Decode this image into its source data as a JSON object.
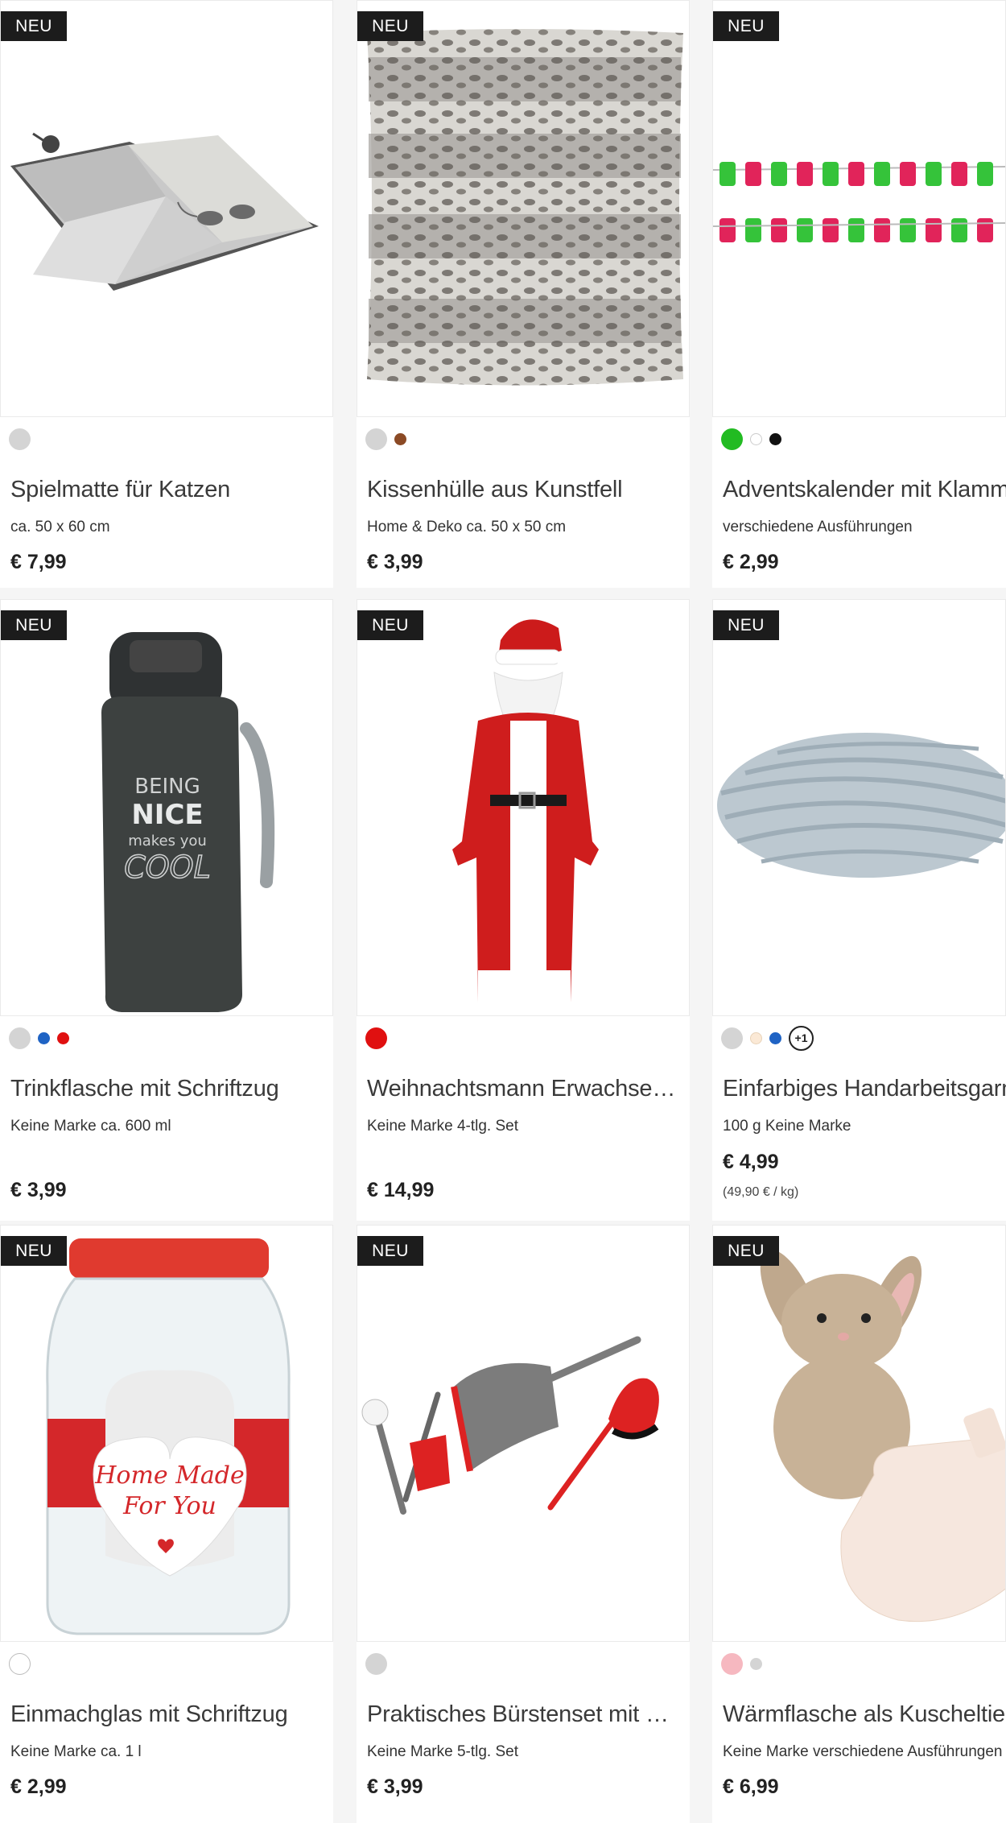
{
  "badge_label": "NEU",
  "products": [
    {
      "title": "Spielmatte für Katzen",
      "subtitle": "ca. 50 x 60 cm",
      "price": "€ 7,99",
      "image_icon": "cat-play-mat-image",
      "swatches": [
        {
          "color": "#d4d4d4",
          "size": "big"
        }
      ]
    },
    {
      "title": "Kissenhülle aus Kunstfell",
      "subtitle": "Home & Deko ca. 50 x 50 cm",
      "price": "€ 3,99",
      "image_icon": "fur-cushion-image",
      "swatches": [
        {
          "color": "#d4d4d4",
          "size": "big"
        },
        {
          "color": "#8b4a25",
          "size": "small"
        }
      ]
    },
    {
      "title": "Adventskalender mit Klammern",
      "subtitle": "verschiedene Ausführungen",
      "price": "€ 2,99",
      "image_icon": "advent-calendar-clips-image",
      "swatches": [
        {
          "color": "#22bb22",
          "size": "big"
        },
        {
          "color": "#ffffff",
          "size": "small"
        },
        {
          "color": "#111111",
          "size": "small"
        }
      ]
    },
    {
      "title": "Trinkflasche mit Schriftzug",
      "subtitle": "Keine Marke ca. 600 ml",
      "price": "€ 3,99",
      "image_icon": "drinking-bottle-image",
      "bottle_text": [
        "BEING",
        "NICE",
        "makes you",
        "COOL"
      ],
      "swatches": [
        {
          "color": "#d4d4d4",
          "size": "big"
        },
        {
          "color": "#1f63c4",
          "size": "small"
        },
        {
          "color": "#e01010",
          "size": "small"
        }
      ]
    },
    {
      "title": "Weihnachtsmann Erwachsene...",
      "subtitle": "Keine Marke 4-tlg. Set",
      "price": "€ 14,99",
      "image_icon": "santa-costume-image",
      "swatches": [
        {
          "color": "#e01010",
          "size": "big"
        }
      ]
    },
    {
      "title": "Einfarbiges Handarbeitsgarn",
      "subtitle": "100 g Keine Marke",
      "price": "€ 4,99",
      "unit_price": "(49,90 € / kg)",
      "image_icon": "yarn-ball-image",
      "swatches": [
        {
          "color": "#d4d4d4",
          "size": "big"
        },
        {
          "color": "#fbe9d6",
          "size": "small"
        },
        {
          "color": "#1f63c4",
          "size": "small"
        }
      ],
      "more_label": "+1"
    },
    {
      "title": "Einmachglas mit Schriftzug",
      "subtitle": "Keine Marke ca. 1 l",
      "price": "€ 2,99",
      "image_icon": "preserving-jar-image",
      "jar_text": [
        "Home Made",
        "For You"
      ],
      "swatches": [
        {
          "color": "#ffffff",
          "size": "big"
        }
      ]
    },
    {
      "title": "Praktisches Bürstenset mit Ke...",
      "subtitle": "Keine Marke 5-tlg. Set",
      "price": "€ 3,99",
      "image_icon": "brush-set-image",
      "swatches": [
        {
          "color": "#d4d4d4",
          "size": "big"
        }
      ]
    },
    {
      "title": "Wärmflasche als Kuscheltier",
      "subtitle": "Keine Marke verschiedene Ausführungen",
      "price": "€ 6,99",
      "image_icon": "hot-water-bottle-bunny-image",
      "swatches": [
        {
          "color": "#f6b8c0",
          "size": "big"
        },
        {
          "color": "#d4d4d4",
          "size": "small"
        }
      ]
    }
  ]
}
